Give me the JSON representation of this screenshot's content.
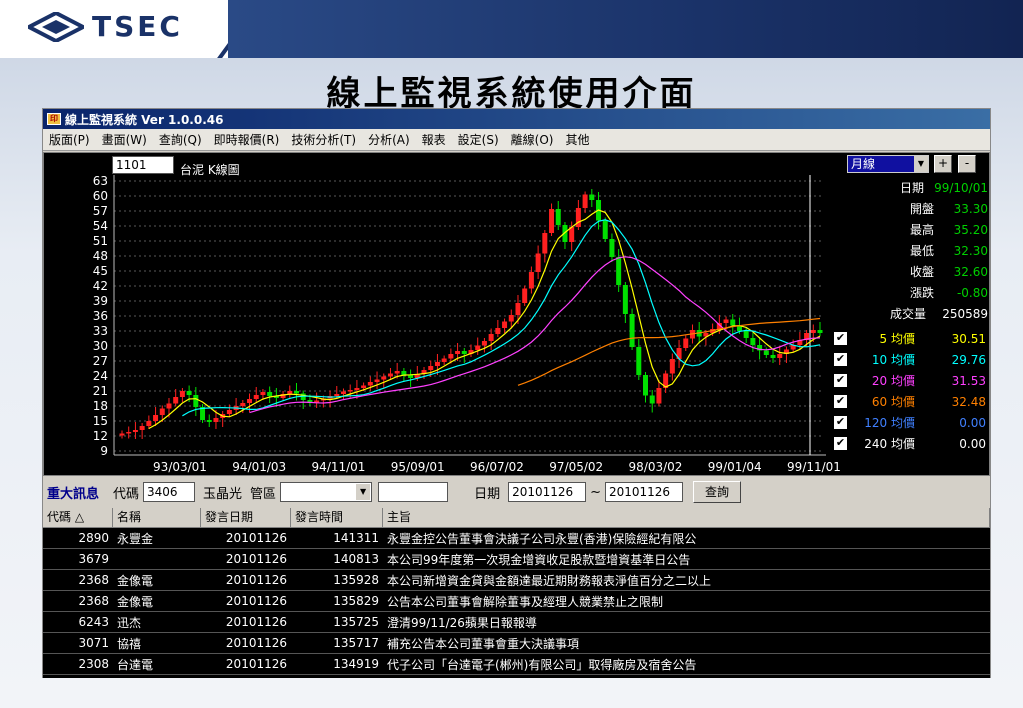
{
  "slide": {
    "logo_text": "TSEC",
    "title": "線上監視系統使用介面"
  },
  "window": {
    "title": "線上監視系統 Ver 1.0.0.46"
  },
  "menu": [
    "版面(P)",
    "畫面(W)",
    "查詢(Q)",
    "即時報價(R)",
    "技術分析(T)",
    "分析(A)",
    "報表",
    "設定(S)",
    "離線(O)",
    "其他"
  ],
  "chart_header": {
    "stock_code": "1101",
    "chart_title": "台泥 K線圖",
    "period": "月線",
    "zoom_in": "+",
    "zoom_out": "-"
  },
  "quote": [
    {
      "label": "日期",
      "value": "99/10/01",
      "color": "#00d000"
    },
    {
      "label": "開盤",
      "value": "33.30",
      "color": "#00d000"
    },
    {
      "label": "最高",
      "value": "35.20",
      "color": "#00d000"
    },
    {
      "label": "最低",
      "value": "32.30",
      "color": "#00d000"
    },
    {
      "label": "收盤",
      "value": "32.60",
      "color": "#00d000"
    },
    {
      "label": "漲跌",
      "value": "-0.80",
      "color": "#00d000"
    },
    {
      "label": "成交量",
      "value": "250589",
      "color": "#ffffff"
    }
  ],
  "moving_averages": [
    {
      "label": "5 均價",
      "value": "30.51",
      "color": "#ffff00"
    },
    {
      "label": "10 均價",
      "value": "29.76",
      "color": "#00ffff"
    },
    {
      "label": "20 均價",
      "value": "31.53",
      "color": "#ff40ff"
    },
    {
      "label": "60 均價",
      "value": "32.48",
      "color": "#ff8000"
    },
    {
      "label": "120 均價",
      "value": "0.00",
      "color": "#4080ff"
    },
    {
      "label": "240 均價",
      "value": "0.00",
      "color": "#ffffff"
    }
  ],
  "chart_data": {
    "type": "candlestick",
    "y_ticks": [
      63,
      60,
      57,
      54,
      51,
      48,
      45,
      42,
      39,
      36,
      33,
      30,
      27,
      24,
      21,
      18,
      15,
      12,
      9
    ],
    "x_ticks": [
      "93/03/01",
      "94/01/03",
      "94/11/01",
      "95/09/01",
      "96/07/02",
      "97/05/02",
      "98/03/02",
      "99/01/04",
      "99/11/01"
    ],
    "ylim": [
      9,
      63
    ],
    "grid": true,
    "series_colors": {
      "up": "#ff2020",
      "down": "#00e000"
    },
    "candles_close": [
      12.5,
      12.8,
      13.2,
      14.0,
      15.0,
      16.2,
      17.5,
      18.5,
      19.8,
      21.0,
      20.2,
      17.8,
      15.2,
      14.8,
      15.6,
      16.4,
      17.2,
      18.0,
      18.6,
      19.4,
      20.2,
      20.8,
      20.0,
      19.6,
      20.4,
      21.0,
      20.5,
      19.2,
      18.6,
      19.1,
      19.5,
      20.0,
      20.4,
      20.9,
      21.2,
      21.6,
      22.1,
      22.8,
      23.3,
      23.9,
      24.5,
      25.0,
      24.2,
      23.6,
      24.4,
      25.2,
      26.0,
      26.8,
      27.5,
      28.4,
      29.0,
      28.4,
      29.2,
      30.1,
      31.0,
      32.4,
      33.6,
      34.9,
      36.2,
      38.6,
      41.5,
      44.8,
      48.5,
      52.6,
      57.4,
      54.2,
      50.8,
      53.8,
      57.6,
      60.3,
      59.2,
      55.1,
      51.4,
      47.8,
      42.2,
      36.4,
      29.8,
      24.2,
      20.1,
      18.5,
      21.6,
      24.5,
      27.4,
      29.6,
      31.5,
      33.2,
      31.9,
      32.6,
      33.4,
      34.6,
      35.3,
      34.1,
      33.0,
      31.6,
      30.2,
      29.1,
      28.2,
      27.6,
      28.4,
      29.3,
      30.2,
      31.2,
      32.6,
      33.2,
      32.6
    ]
  },
  "news_bar": {
    "title": "重大訊息",
    "code_label": "代碼",
    "code_value": "3406",
    "name": "玉晶光",
    "zone_label": "管區",
    "zone_value": "",
    "extra_value": "",
    "date_label": "日期",
    "date_from": "20101126",
    "date_sep": "~",
    "date_to": "20101126",
    "query_button": "查詢"
  },
  "table": {
    "headers": [
      "代碼 △",
      "名稱",
      "發言日期",
      "發言時間",
      "主旨"
    ],
    "rows": [
      [
        "2890",
        "永豐金",
        "20101126",
        "141311",
        "永豐金控公告董事會決議子公司永豐(香港)保險經紀有限公"
      ],
      [
        "3679",
        "",
        "20101126",
        "140813",
        "本公司99年度第一次現金增資收足股款暨增資基準日公告"
      ],
      [
        "2368",
        "金像電",
        "20101126",
        "135928",
        "本公司新增資金貸與金額達最近期財務報表淨值百分之二以上"
      ],
      [
        "2368",
        "金像電",
        "20101126",
        "135829",
        "公告本公司董事會解除董事及經理人競業禁止之限制"
      ],
      [
        "6243",
        "迅杰",
        "20101126",
        "135725",
        "澄清99/11/26蘋果日報報導"
      ],
      [
        "3071",
        "協禧",
        "20101126",
        "135717",
        "補充公告本公司董事會重大決議事項"
      ],
      [
        "2308",
        "台達電",
        "20101126",
        "134919",
        "代子公司「台達電子(郴州)有限公司」取得廠房及宿舍公告"
      ]
    ]
  }
}
